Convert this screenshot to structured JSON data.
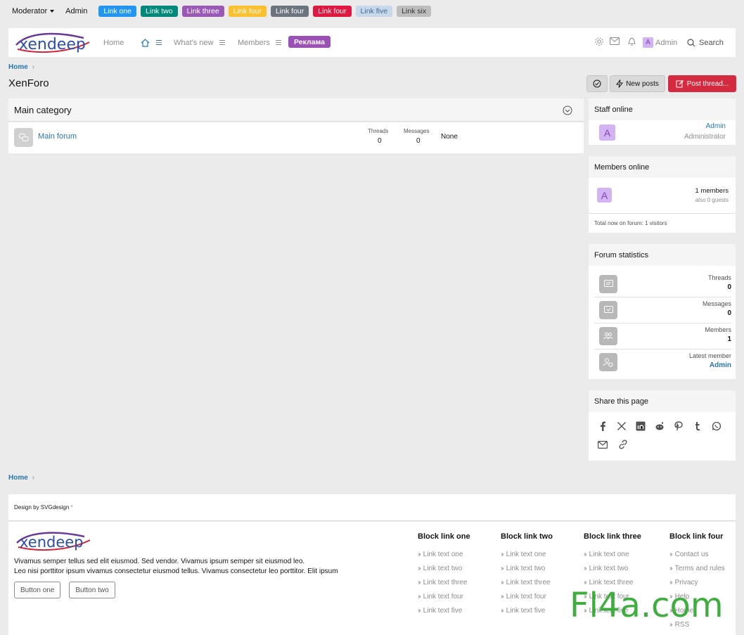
{
  "topbar": {
    "moderator": "Moderator",
    "admin": "Admin",
    "links": [
      {
        "label": "Link one",
        "bg": "#2196f3",
        "fg": "#ffffff"
      },
      {
        "label": "Link two",
        "bg": "#00897b",
        "fg": "#ffffff"
      },
      {
        "label": "Link three",
        "bg": "#9b59b6",
        "fg": "#ffffff"
      },
      {
        "label": "Link four",
        "bg": "#fbc02d",
        "fg": "#ffffff"
      },
      {
        "label": "Link four",
        "bg": "#6c757d",
        "fg": "#ffffff"
      },
      {
        "label": "Link four",
        "bg": "#e0173f",
        "fg": "#ffffff"
      },
      {
        "label": "Link five",
        "bg": "#c7d8ea",
        "fg": "#3e6b99"
      },
      {
        "label": "Link six",
        "bg": "#bdbdbd",
        "fg": "#333333"
      }
    ]
  },
  "nav": {
    "home": "Home",
    "whats_new": "What's new",
    "members": "Members",
    "reklama": "Реклама",
    "user": "Admin",
    "user_initial": "A",
    "search": "Search"
  },
  "breadcrumb": {
    "home": "Home"
  },
  "page": {
    "title": "XenForo"
  },
  "actions": {
    "new_posts": "New posts",
    "post_thread": "Post thread..."
  },
  "category": {
    "title": "Main category",
    "forum": {
      "name": "Main forum",
      "threads_label": "Threads",
      "threads": "0",
      "messages_label": "Messages",
      "messages": "0",
      "last": "None"
    }
  },
  "staff_online": {
    "title": "Staff online",
    "user": "Admin",
    "role": "Administrator",
    "initial": "A"
  },
  "members_online": {
    "title": "Members online",
    "initial": "A",
    "count": "1 members",
    "guests": "also 0 guests",
    "total": "Total now on forum: 1 visitors"
  },
  "forum_stats": {
    "title": "Forum statistics",
    "threads_label": "Threads",
    "threads": "0",
    "messages_label": "Messages",
    "messages": "0",
    "members_label": "Members",
    "members": "1",
    "latest_label": "Latest member",
    "latest": "Admin"
  },
  "share": {
    "title": "Share this page"
  },
  "footer": {
    "design": "Design by SVGdesign",
    "design_mark": "*",
    "text1": "Vivamus semper tellus sed elit eiusmod. Sed vendor. Vivamus ipsum semper sit eiusmod leo.",
    "text2": "Leo nisi porttitor ipsum vivamus consectetur eiusmod tellus. Vivamus consectetur leo porttitor. Elit ipsum",
    "button_one": "Button one",
    "button_two": "Button two",
    "cols": [
      {
        "title": "Block link one",
        "links": [
          "Link text one",
          "Link text two",
          "Link text three",
          "Link text four",
          "Link text five"
        ]
      },
      {
        "title": "Block link two",
        "links": [
          "Link text one",
          "Link text two",
          "Link text three",
          "Link text four",
          "Link text five"
        ]
      },
      {
        "title": "Block link three",
        "links": [
          "Link text one",
          "Link text two",
          "Link text three",
          "Link text four",
          "Link text five"
        ]
      },
      {
        "title": "Block link four",
        "links": [
          "Contact us",
          "Terms and rules",
          "Privacy",
          "Help",
          "Home",
          "RSS"
        ]
      }
    ]
  },
  "logo_text": "xendeep",
  "watermark": "Fl4a.com"
}
